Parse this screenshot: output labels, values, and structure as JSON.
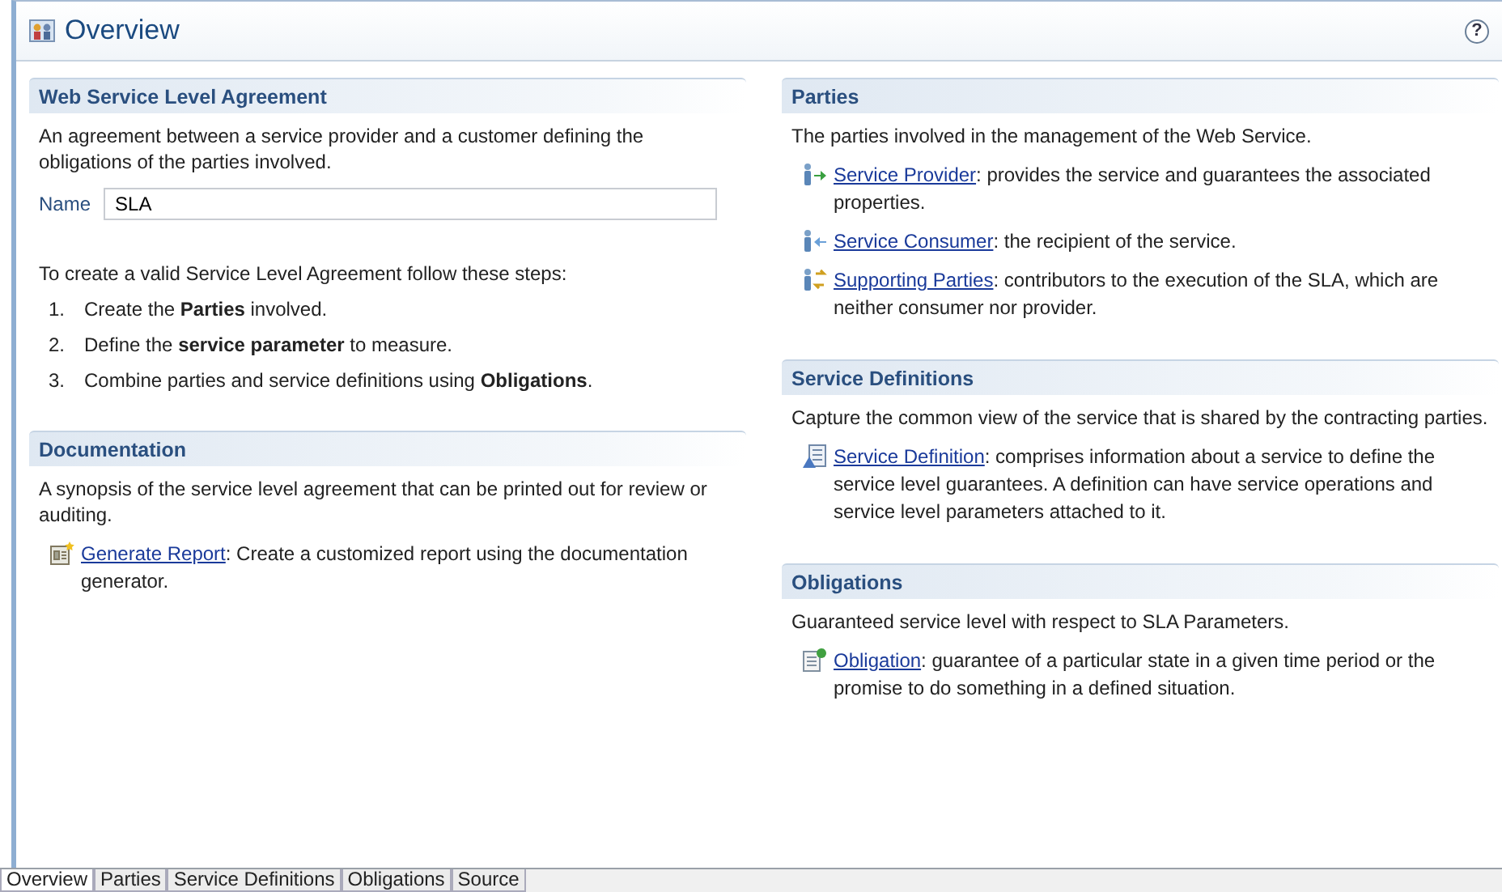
{
  "header": {
    "title": "Overview",
    "help": "?"
  },
  "columns": [
    [
      {
        "title": "Web Service Level Agreement",
        "description": "An agreement between a service provider and a customer defining the obligations of the parties involved.",
        "name_field": {
          "label": "Name",
          "value": "SLA"
        },
        "intro": "To create a valid Service Level Agreement follow these steps:",
        "steps": [
          {
            "number": "1.",
            "text": "Create the **Parties** involved."
          },
          {
            "number": "2.",
            "text": "Define the **service parameter** to measure."
          },
          {
            "number": "3.",
            "text": "Combine parties and service definitions using **Obligations**."
          }
        ]
      },
      {
        "title": "Documentation",
        "description": "A synopsis of the service level agreement that can be printed out for review or auditing.",
        "links": [
          {
            "kind": "report",
            "link": "Generate Report",
            "text": ": Create a customized report using the documentation generator."
          }
        ]
      }
    ],
    [
      {
        "title": "Parties",
        "description": "The parties involved in the management of the Web Service.",
        "links": [
          {
            "kind": "provider",
            "link": "Service Provider",
            "text": ": provides the service and guarantees the associated properties."
          },
          {
            "kind": "consumer",
            "link": "Service Consumer",
            "text": ": the recipient of the service."
          },
          {
            "kind": "supporting",
            "link": "Supporting Parties",
            "text": ": contributors to the execution of the SLA, which are neither consumer nor provider."
          }
        ]
      },
      {
        "title": "Service Definitions",
        "description": "Capture the common view of the service that is shared by the contracting parties.",
        "links": [
          {
            "kind": "definition",
            "link": "Service Definition",
            "text": ": comprises information about a service to define the service level guarantees. A definition can have service operations and service level parameters attached to it."
          }
        ]
      },
      {
        "title": "Obligations",
        "description": "Guaranteed service level with respect to SLA Parameters.",
        "links": [
          {
            "kind": "obligation",
            "link": "Obligation",
            "text": ": guarantee of a particular state in a given time period or the promise to do something in a defined situation."
          }
        ]
      }
    ]
  ],
  "tabs": [
    {
      "label": "Overview",
      "selected": true
    },
    {
      "label": "Parties",
      "selected": false
    },
    {
      "label": "Service Definitions",
      "selected": false
    },
    {
      "label": "Obligations",
      "selected": false
    },
    {
      "label": "Source",
      "selected": false
    }
  ]
}
